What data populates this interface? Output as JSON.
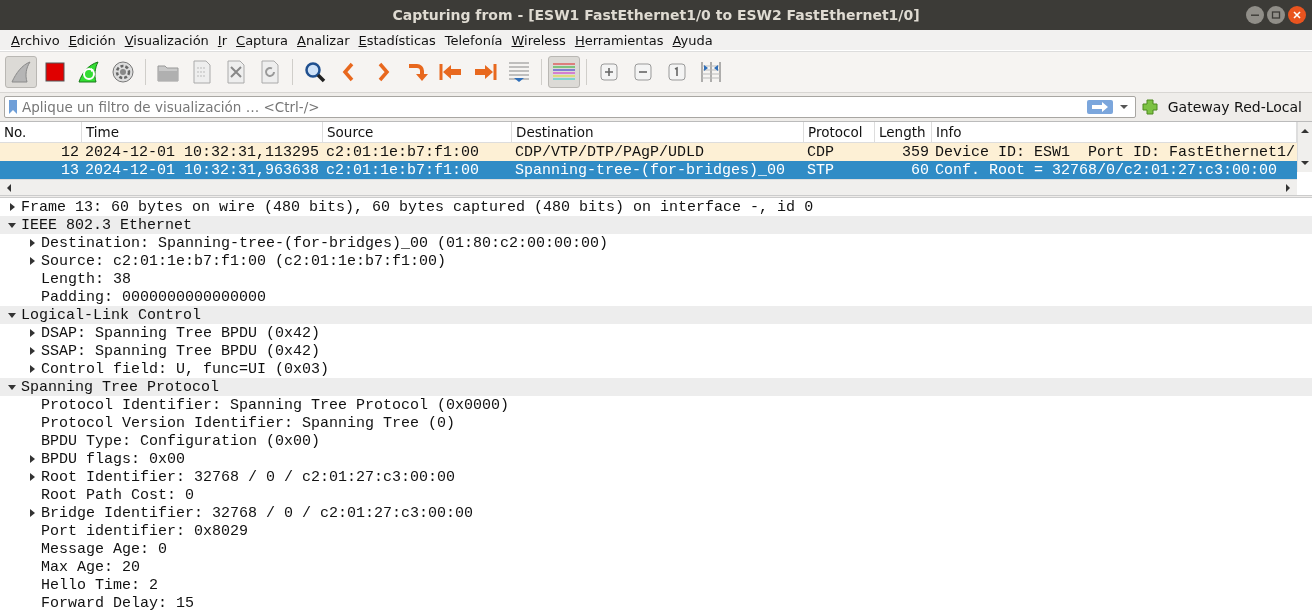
{
  "window": {
    "title": "Capturing from - [ESW1 FastEthernet1/0 to ESW2 FastEthernet1/0]"
  },
  "menu": [
    {
      "label": "Archivo",
      "underline_first": true
    },
    {
      "label": "Edición",
      "underline_first": true
    },
    {
      "label": "Visualización",
      "underline_first": true
    },
    {
      "label": "Ir",
      "underline_first": true
    },
    {
      "label": "Captura",
      "underline_first": true
    },
    {
      "label": "Analizar",
      "underline_first": true
    },
    {
      "label": "Estadísticas",
      "underline_first": true
    },
    {
      "label": "Telefonía",
      "underline_first": false
    },
    {
      "label": "Wireless",
      "underline_first": true
    },
    {
      "label": "Herramientas",
      "underline_first": true
    },
    {
      "label": "Ayuda",
      "underline_first": true
    }
  ],
  "filter": {
    "placeholder": "Aplique un filtro de visualización … <Ctrl-/>",
    "button": "Gateway Red-Local"
  },
  "packet_list": {
    "columns": [
      "No.",
      "Time",
      "Source",
      "Destination",
      "Protocol",
      "Length",
      "Info"
    ],
    "rows": [
      {
        "cells": [
          "12",
          "2024-12-01 10:32:31,113295",
          "c2:01:1e:b7:f1:00",
          "CDP/VTP/DTP/PAgP/UDLD",
          "CDP",
          "359",
          "Device ID: ESW1  Port ID: FastEthernet1/"
        ],
        "selected": false,
        "color": "#fdf0d5"
      },
      {
        "cells": [
          "13",
          "2024-12-01 10:32:31,963638",
          "c2:01:1e:b7:f1:00",
          "Spanning-tree-(for-bridges)_00",
          "STP",
          "60",
          "Conf. Root = 32768/0/c2:01:27:c3:00:00"
        ],
        "selected": true
      }
    ]
  },
  "details": [
    {
      "text": "Frame 13: 60 bytes on wire (480 bits), 60 bytes captured (480 bits) on interface -, id 0",
      "expanded": false
    },
    {
      "text": "IEEE 802.3 Ethernet",
      "expanded": true,
      "children": [
        {
          "text": "Destination: Spanning-tree-(for-bridges)_00 (01:80:c2:00:00:00)",
          "expanded": false
        },
        {
          "text": "Source: c2:01:1e:b7:f1:00 (c2:01:1e:b7:f1:00)",
          "expanded": false
        },
        {
          "text": "Length: 38"
        },
        {
          "text": "Padding: 0000000000000000"
        }
      ]
    },
    {
      "text": "Logical-Link Control",
      "expanded": true,
      "children": [
        {
          "text": "DSAP: Spanning Tree BPDU (0x42)",
          "expanded": false
        },
        {
          "text": "SSAP: Spanning Tree BPDU (0x42)",
          "expanded": false
        },
        {
          "text": "Control field: U, func=UI (0x03)",
          "expanded": false
        }
      ]
    },
    {
      "text": "Spanning Tree Protocol",
      "expanded": true,
      "children": [
        {
          "text": "Protocol Identifier: Spanning Tree Protocol (0x0000)"
        },
        {
          "text": "Protocol Version Identifier: Spanning Tree (0)"
        },
        {
          "text": "BPDU Type: Configuration (0x00)"
        },
        {
          "text": "BPDU flags: 0x00",
          "expanded": false
        },
        {
          "text": "Root Identifier: 32768 / 0 / c2:01:27:c3:00:00",
          "expanded": false
        },
        {
          "text": "Root Path Cost: 0"
        },
        {
          "text": "Bridge Identifier: 32768 / 0 / c2:01:27:c3:00:00",
          "expanded": false
        },
        {
          "text": "Port identifier: 0x8029"
        },
        {
          "text": "Message Age: 0"
        },
        {
          "text": "Max Age: 20"
        },
        {
          "text": "Hello Time: 2"
        },
        {
          "text": "Forward Delay: 15"
        }
      ]
    }
  ]
}
